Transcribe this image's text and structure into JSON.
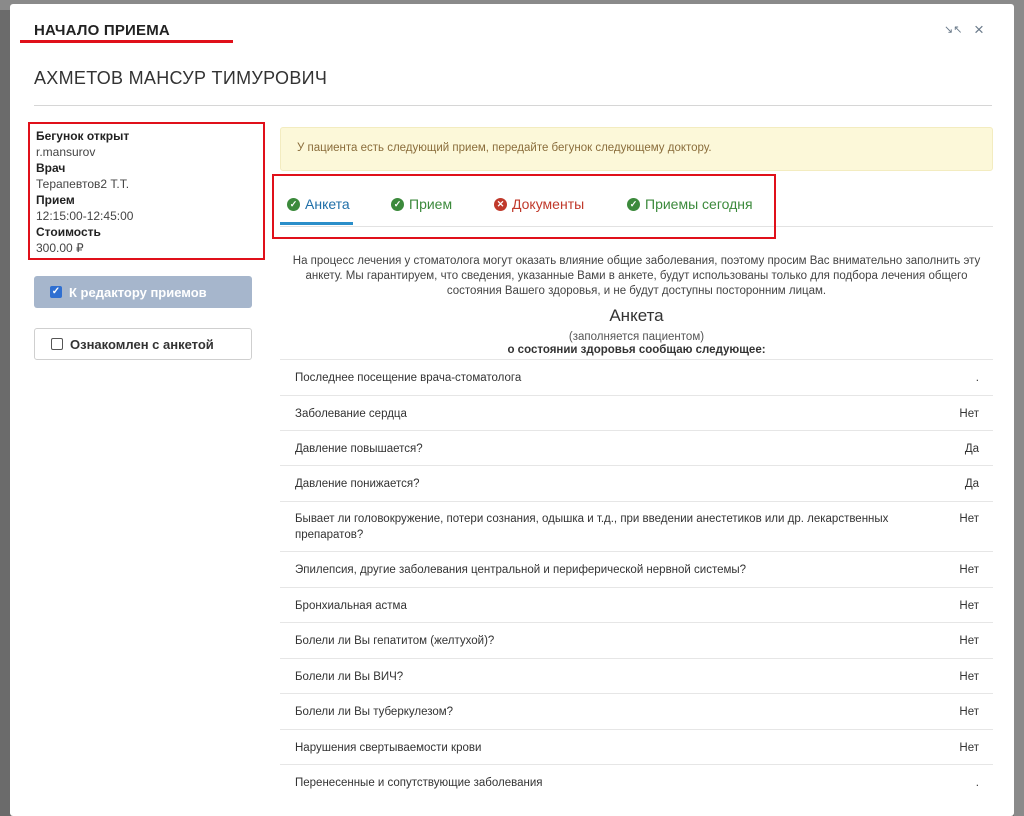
{
  "modal": {
    "title": "НАЧАЛО ПРИЕМА",
    "compress_icon": "compress-icon",
    "close_icon": "close-icon",
    "close_glyph": "×"
  },
  "patient": {
    "name": "АХМЕТОВ МАНСУР ТИМУРОВИЧ"
  },
  "info": {
    "runner_label": "Бегунок открыт",
    "runner_value": "r.mansurov",
    "doctor_label": "Врач",
    "doctor_value": "Терапевтов2 Т.Т.",
    "appointment_label": "Прием",
    "appointment_value": "12:15:00-12:45:00",
    "cost_label": "Стоимость",
    "cost_value": "300.00 ₽"
  },
  "buttons": {
    "editor_label": "К редактору приемов",
    "ack_label": "Ознакомлен с анкетой"
  },
  "alert": {
    "text": "У пациента есть следующий прием, передайте бегунок следующему доктору."
  },
  "tabs": [
    {
      "label": "Анкета",
      "status": "ok",
      "active": true
    },
    {
      "label": "Прием",
      "status": "ok",
      "active": false
    },
    {
      "label": "Документы",
      "status": "error",
      "active": false
    },
    {
      "label": "Приемы сегодня",
      "status": "ok",
      "active": false
    }
  ],
  "form": {
    "intro": "На процесс лечения у стоматолога могут оказать влияние общие заболевания, поэтому просим Вас внимательно заполнить эту анкету. Мы гарантируем, что сведения, указанные Вами в анкете, будут использованы только для подбора лечения общего состояния Вашего здоровья, и не будут доступны посторонним лицам.",
    "title": "Анкета",
    "subtitle": "(заполняется пациентом)",
    "subtitle2": "о состоянии здоровья сообщаю следующее:",
    "questions": [
      {
        "q": "Последнее посещение врача-стоматолога",
        "a": "."
      },
      {
        "q": "Заболевание сердца",
        "a": "Нет"
      },
      {
        "q": "Давление повышается?",
        "a": "Да"
      },
      {
        "q": "Давление понижается?",
        "a": "Да"
      },
      {
        "q": "Бывает ли головокружение, потери сознания, одышка и т.д., при введении анестетиков или др. лекарственных препаратов?",
        "a": "Нет"
      },
      {
        "q": "Эпилепсия, другие заболевания центральной и периферической нервной системы?",
        "a": "Нет"
      },
      {
        "q": "Бронхиальная астма",
        "a": "Нет"
      },
      {
        "q": "Болели ли Вы гепатитом (желтухой)?",
        "a": "Нет"
      },
      {
        "q": "Болели ли Вы ВИЧ?",
        "a": "Нет"
      },
      {
        "q": "Болели ли Вы туберкулезом?",
        "a": "Нет"
      },
      {
        "q": "Нарушения свертываемости крови",
        "a": "Нет"
      },
      {
        "q": "Перенесенные и сопутствующие заболевания",
        "a": "."
      }
    ]
  }
}
